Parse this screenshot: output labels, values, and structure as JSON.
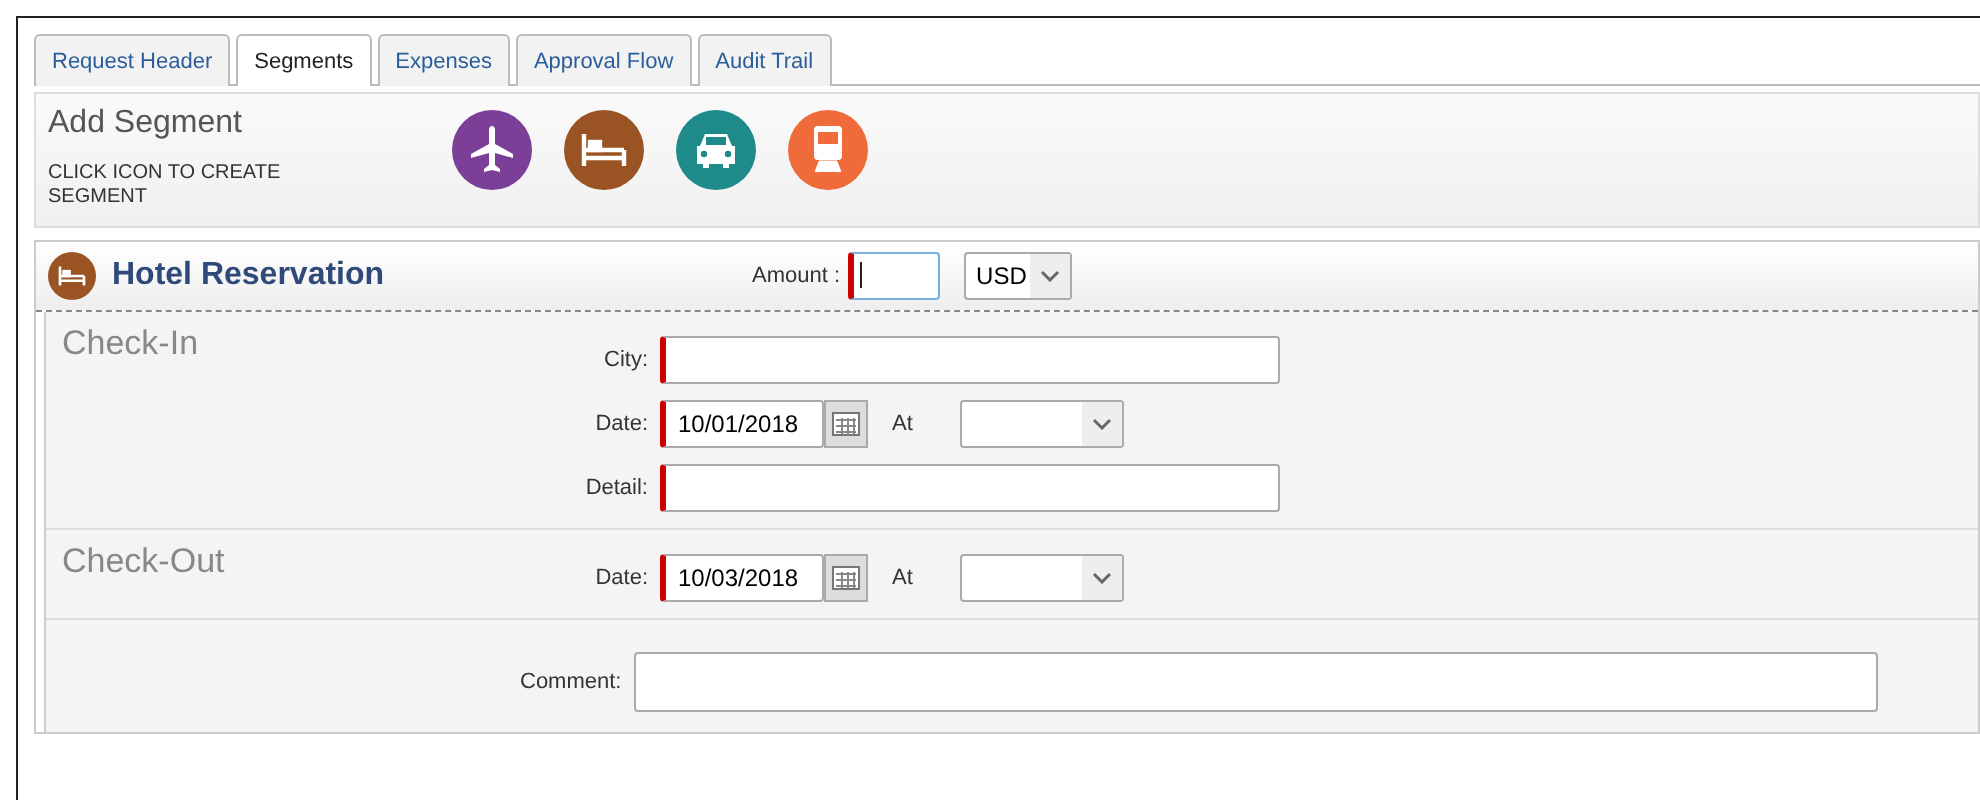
{
  "tabs": [
    {
      "label": "Request Header",
      "selected": false
    },
    {
      "label": "Segments",
      "selected": true
    },
    {
      "label": "Expenses",
      "selected": false
    },
    {
      "label": "Approval Flow",
      "selected": false
    },
    {
      "label": "Audit Trail",
      "selected": false
    }
  ],
  "add_segment": {
    "title": "Add Segment",
    "hint": "CLICK ICON TO CREATE SEGMENT",
    "icons": [
      {
        "kind": "plane",
        "color": "#7b3f98"
      },
      {
        "kind": "bed",
        "color": "#9a5424"
      },
      {
        "kind": "car",
        "color": "#1f8a8a"
      },
      {
        "kind": "train",
        "color": "#ef6b3a"
      }
    ]
  },
  "segment": {
    "title": "Hotel Reservation",
    "amount": {
      "label": "Amount :",
      "required": true,
      "focused": true
    },
    "currency": {
      "value": "USD"
    },
    "sections": [
      {
        "title": "Check-In",
        "fields": [
          {
            "kind": "text",
            "label": "City:",
            "required": true
          },
          {
            "kind": "date",
            "label": "Date:",
            "value": "10/01/2018",
            "required": true,
            "at_label": "At"
          },
          {
            "kind": "text",
            "label": "Detail:",
            "required": true
          }
        ]
      },
      {
        "title": "Check-Out",
        "fields": [
          {
            "kind": "date",
            "label": "Date:",
            "value": "10/03/2018",
            "required": true,
            "at_label": "At"
          }
        ]
      }
    ],
    "comment": {
      "label": "Comment:",
      "required": false
    }
  }
}
